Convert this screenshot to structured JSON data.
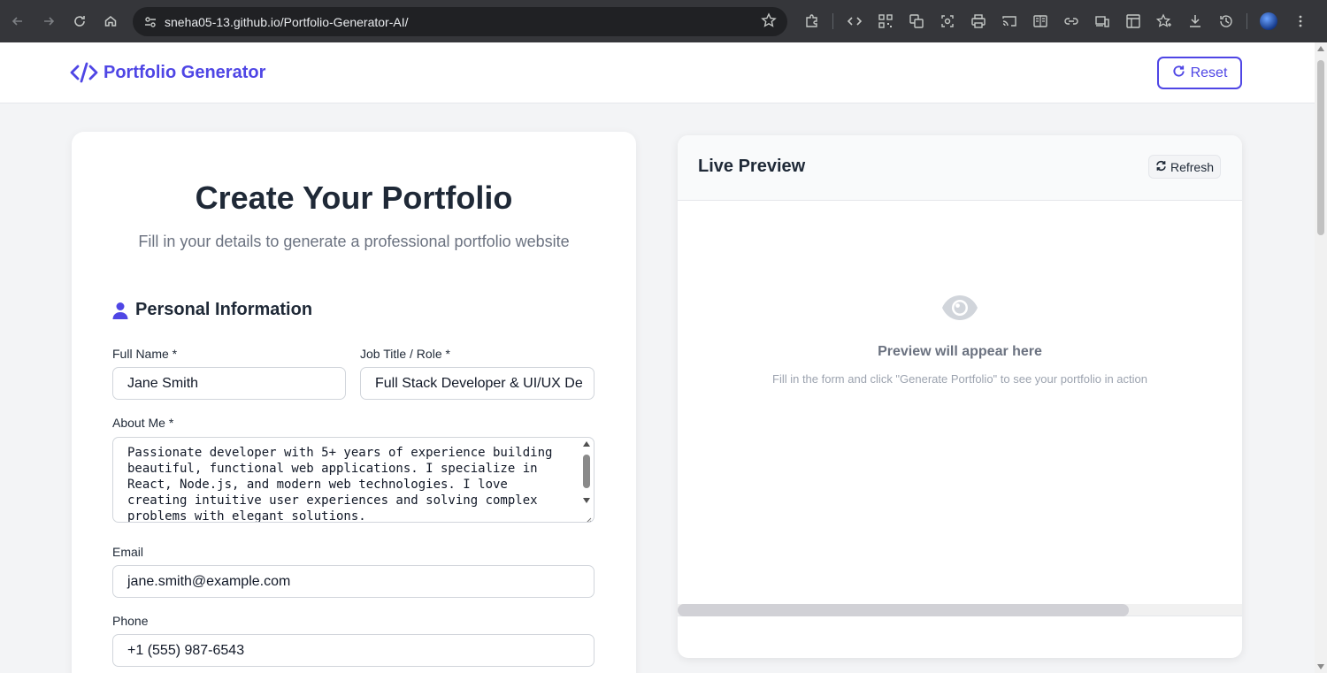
{
  "browser": {
    "url": "sneha05-13.github.io/Portfolio-Generator-AI/"
  },
  "header": {
    "brand": "Portfolio Generator",
    "reset_label": "Reset"
  },
  "form": {
    "title": "Create Your Portfolio",
    "subtitle": "Fill in your details to generate a professional portfolio website",
    "section_title": "Personal Information",
    "full_name_label": "Full Name *",
    "full_name_value": "Jane Smith",
    "job_title_label": "Job Title / Role *",
    "job_title_value": "Full Stack Developer & UI/UX De",
    "about_label": "About Me *",
    "about_value": "Passionate developer with 5+ years of experience building\nbeautiful, functional web applications. I specialize in\nReact, Node.js, and modern web technologies. I love\ncreating intuitive user experiences and solving complex\nproblems with elegant solutions.",
    "email_label": "Email",
    "email_value": "jane.smith@example.com",
    "phone_label": "Phone",
    "phone_value": "+1 (555) 987-6543"
  },
  "preview": {
    "title": "Live Preview",
    "refresh_label": "Refresh",
    "placeholder_title": "Preview will appear here",
    "placeholder_sub": "Fill in the form and click \"Generate Portfolio\" to see your portfolio in action"
  },
  "colors": {
    "accent": "#4f46e5",
    "chrome": "#35363a"
  }
}
